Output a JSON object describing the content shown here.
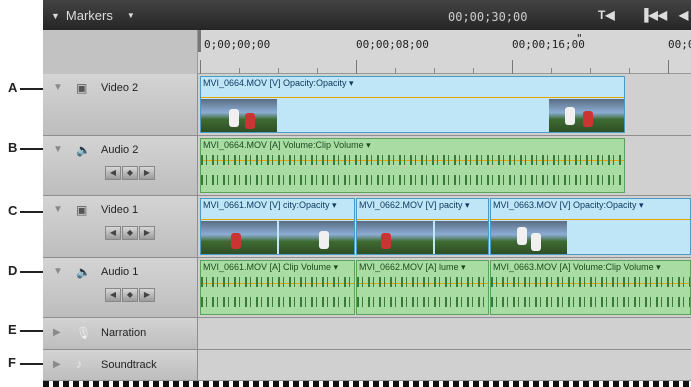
{
  "panel": {
    "title": "Markers",
    "timecode": "00;00;30;00",
    "btn1": "T◀",
    "btn2": "▐◀◀",
    "btn3": "◀"
  },
  "ruler": {
    "labels": [
      "0;00;00;00",
      "00;00;08;00",
      "00;00;16;00",
      "00;0"
    ],
    "marker": "\""
  },
  "callouts": [
    "A",
    "B",
    "C",
    "D",
    "E",
    "F"
  ],
  "nav": [
    "◀",
    "◆",
    "▶"
  ],
  "tracks": [
    {
      "name": "Video 2",
      "clips": [
        {
          "label": "MVI_0664.MOV [V]  Opacity:Opacity ▾"
        }
      ]
    },
    {
      "name": "Audio 2",
      "clips": [
        {
          "label": "MVI_0664.MOV [A]  Volume:Clip Volume ▾"
        }
      ]
    },
    {
      "name": "Video 1",
      "clips": [
        {
          "label": "MVI_0661.MOV [V]  city:Opacity ▾"
        },
        {
          "label": "MVI_0662.MOV [V]  pacity ▾"
        },
        {
          "label": "MVI_0663.MOV [V]  Opacity:Opacity ▾"
        }
      ]
    },
    {
      "name": "Audio 1",
      "clips": [
        {
          "label": "MVI_0661.MOV [A]  Clip Volume ▾"
        },
        {
          "label": "MVI_0662.MOV [A]  lume ▾"
        },
        {
          "label": "MVI_0663.MOV [A]  Volume:Clip Volume ▾"
        }
      ]
    },
    {
      "name": "Narration"
    },
    {
      "name": "Soundtrack"
    }
  ],
  "colors": {
    "video_clip": "#bfe6f6",
    "audio_clip": "#a9dca3",
    "rubber_band": "#e8a300"
  },
  "icons": {
    "video_track": "video-track-icon",
    "audio_track": "speaker-icon",
    "narration": "microphone-icon",
    "soundtrack": "music-note-icon"
  }
}
